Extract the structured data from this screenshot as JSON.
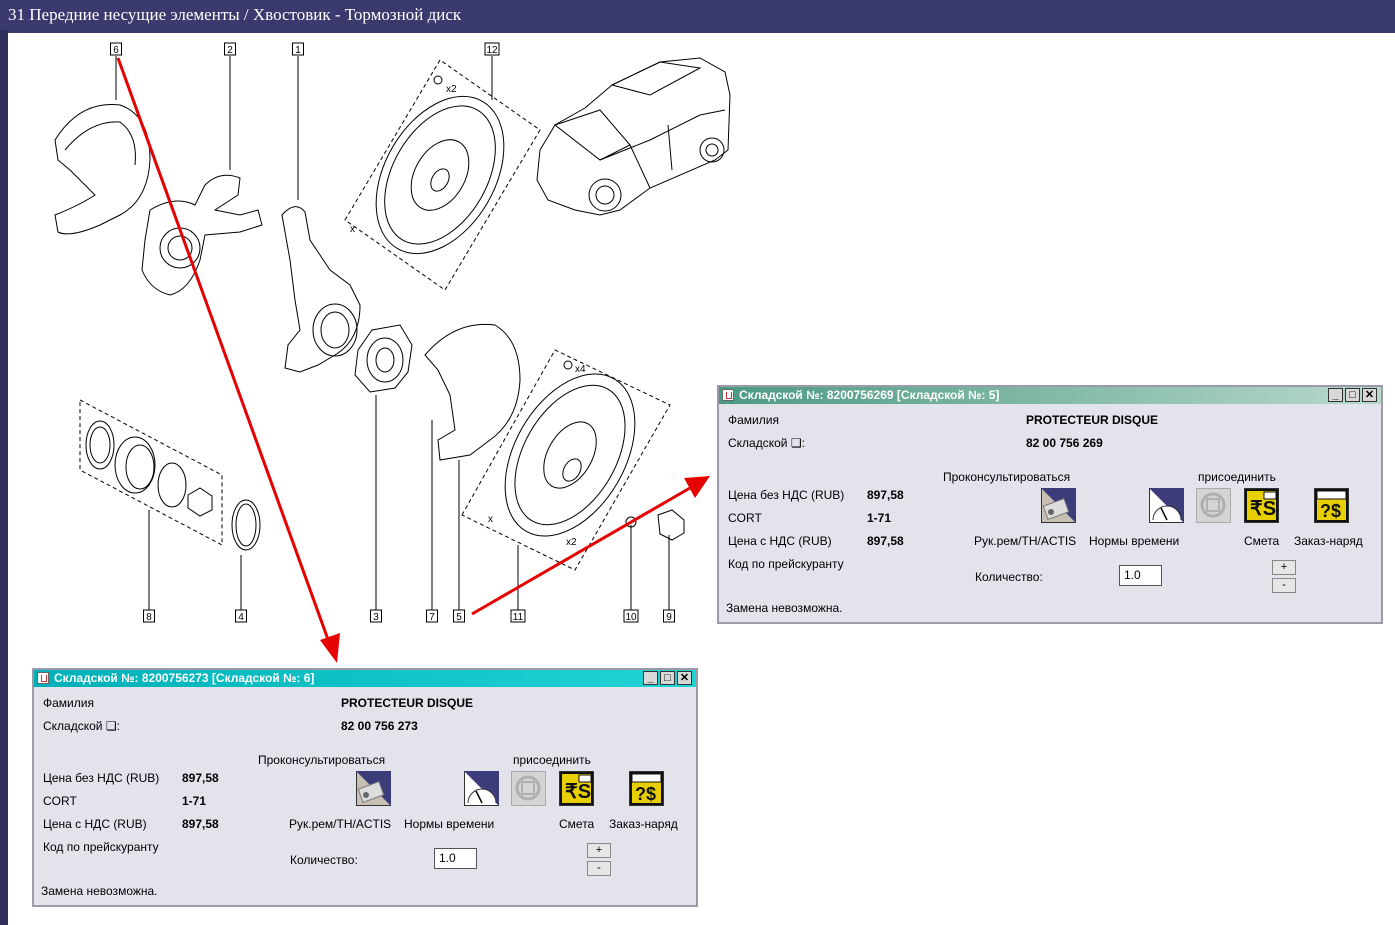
{
  "window": {
    "title": "31 Передние несущие элементы / Хвостовик - Тормозной диск"
  },
  "callouts": [
    "6",
    "2",
    "1",
    "12",
    "8",
    "4",
    "3",
    "7",
    "5",
    "11",
    "10",
    "9"
  ],
  "diagram_labels": {
    "x": "x",
    "x2": "x2",
    "x4": "x4"
  },
  "dialog_right": {
    "caption": "Складской №: 8200756269 [Складской №: 5]",
    "family_label": "Фамилия",
    "family_value": "PROTECTEUR DISQUE",
    "stock_label": "Складской ❑:",
    "stock_value": "82 00 756 269",
    "consult_label": "Проконсультироваться",
    "attach_label": "присоединить",
    "price_no_vat_label": "Цена без НДС (RUB)",
    "price_no_vat_value": "897,58",
    "cort_label": "CORT",
    "cort_value": "1-71",
    "price_vat_label": "Цена с НДС (RUB)",
    "price_vat_value": "897,58",
    "pricelist_code_label": "Код по прейскуранту",
    "icons": {
      "manual": "Рук.рем/TH/ACTIS",
      "time": "Нормы времени",
      "estimate": "Смета",
      "order": "Заказ-наряд"
    },
    "quantity_label": "Количество:",
    "quantity_value": "1.0",
    "plus": "+",
    "minus": "-",
    "status": "Замена невозможна."
  },
  "dialog_left": {
    "caption": "Складской №: 8200756273 [Складской №: 6]",
    "family_label": "Фамилия",
    "family_value": "PROTECTEUR DISQUE",
    "stock_label": "Складской ❑:",
    "stock_value": "82 00 756 273",
    "consult_label": "Проконсультироваться",
    "attach_label": "присоединить",
    "price_no_vat_label": "Цена без НДС (RUB)",
    "price_no_vat_value": "897,58",
    "cort_label": "CORT",
    "cort_value": "1-71",
    "price_vat_label": "Цена с НДС (RUB)",
    "price_vat_value": "897,58",
    "pricelist_code_label": "Код по прейскуранту",
    "icons": {
      "manual": "Рук.рем/TH/ACTIS",
      "time": "Нормы времени",
      "estimate": "Смета",
      "order": "Заказ-наряд"
    },
    "quantity_label": "Количество:",
    "quantity_value": "1.0",
    "plus": "+",
    "minus": "-",
    "status": "Замена невозможна."
  },
  "colors": {
    "title_bar": "#3a3a6e",
    "arrow": "#e60000",
    "right_caption": "#5a9e8a",
    "left_caption": "#00b8c0",
    "dialog_bg": "#e3e3ec"
  }
}
